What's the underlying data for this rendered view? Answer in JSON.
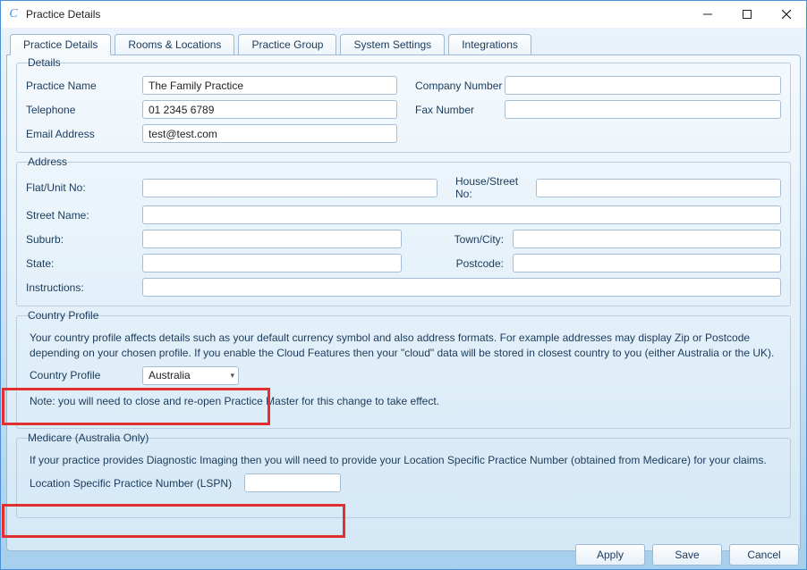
{
  "window": {
    "title": "Practice Details"
  },
  "tabs": [
    {
      "label": "Practice Details"
    },
    {
      "label": "Rooms & Locations"
    },
    {
      "label": "Practice Group"
    },
    {
      "label": "System Settings"
    },
    {
      "label": "Integrations"
    }
  ],
  "details": {
    "legend": "Details",
    "practice_name_label": "Practice Name",
    "practice_name_value": "The Family Practice",
    "company_number_label": "Company Number",
    "company_number_value": "",
    "telephone_label": "Telephone",
    "telephone_value": "01 2345 6789",
    "fax_label": "Fax Number",
    "fax_value": "",
    "email_label": "Email Address",
    "email_value": "test@test.com"
  },
  "address": {
    "legend": "Address",
    "flat_label": "Flat/Unit No:",
    "flat_value": "",
    "house_label": "House/Street No:",
    "house_value": "",
    "street_label": "Street Name:",
    "street_value": "",
    "suburb_label": "Suburb:",
    "suburb_value": "",
    "town_label": "Town/City:",
    "town_value": "",
    "state_label": "State:",
    "state_value": "",
    "postcode_label": "Postcode:",
    "postcode_value": "",
    "instructions_label": "Instructions:",
    "instructions_value": ""
  },
  "country": {
    "legend": "Country Profile",
    "info1": "Your country profile affects details such as your default currency symbol and also address formats. For example addresses may display Zip or Postcode depending on your chosen profile. If you enable the Cloud Features then your \"cloud\" data will be stored in closest country to you (either Australia or the UK).",
    "profile_label": "Country Profile",
    "profile_value": "Australia",
    "note": "Note: you will need to close and re-open Practice Master for this change to take effect."
  },
  "medicare": {
    "legend": "Medicare (Australia Only)",
    "info": "If your practice provides Diagnostic Imaging then you will need to provide your Location Specific Practice Number (obtained from Medicare) for your claims.",
    "lspn_label": "Location Specific Practice Number (LSPN)",
    "lspn_value": ""
  },
  "footer": {
    "apply": "Apply",
    "save": "Save",
    "cancel": "Cancel"
  }
}
